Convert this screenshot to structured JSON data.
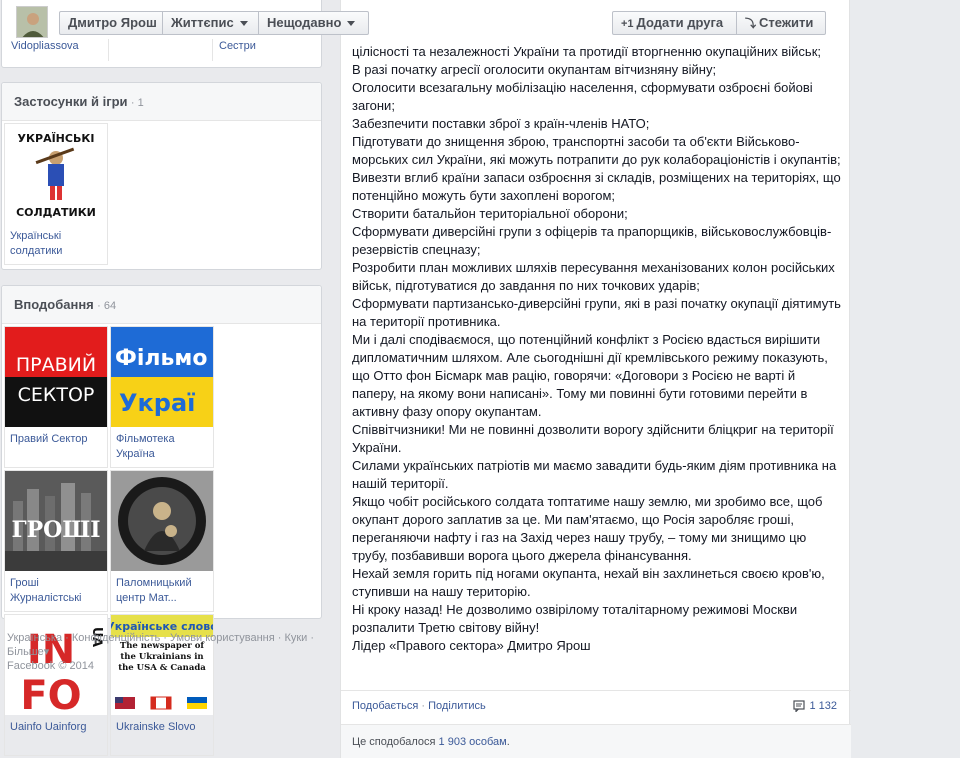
{
  "header": {
    "profile_name": "Дмитро Ярош",
    "timeline_label": "Життєпис",
    "recent_label": "Нещодавно",
    "add_friend_label": "Додати друга",
    "add_friend_icon": "+1",
    "follow_label": "Стежити",
    "follow_icon": "⤵"
  },
  "friends_tail": {
    "cells": [
      "Vidopliassova",
      "",
      "Сестри"
    ]
  },
  "apps": {
    "title": "Застосунки й ігри",
    "count": "· 1",
    "items": [
      {
        "label": "Українські солдатики",
        "art_top": "УКРАЇНСЬКІ",
        "art_bottom": "СОЛДАТИКИ"
      }
    ]
  },
  "likes": {
    "title": "Вподобання",
    "count": "· 64",
    "items": [
      {
        "label": "Правий Сектор",
        "art_line1": "ПРАВИЙ",
        "art_line2": "СЕКТОР"
      },
      {
        "label": "Фільмотека Україна",
        "art_line1": "Фільмо",
        "art_line2": "Украї"
      },
      {
        "label": "Гроші Журналістські",
        "art_line1": "ГРОШІ"
      },
      {
        "label": "Паломницький центр Мат...",
        "art_ring": "ПАЛОМНИЦЬКИЙ ЦЕНТР"
      },
      {
        "label": "Uainfo Uainforg",
        "art_line1": "IN",
        "art_line2": "FO",
        "art_badge": "UA"
      },
      {
        "label": "Ukrainske Slovo",
        "art_line1": "Українське слово",
        "art_line2": "The newspaper of the Ukrainians in the USA & Canada"
      }
    ]
  },
  "footer": {
    "links": [
      "Українська",
      "Конфіденційність",
      "Умови користування",
      "Куки",
      "Більше"
    ],
    "copyright": "Facebook © 2014"
  },
  "post": {
    "lines": [
      "цілісності та незалежності України та протидії вторгненню окупаційних військ;",
      "В разі початку агресії оголосити окупантам вітчизняну війну;",
      "Оголосити всезагальну мобілізацію населення, сформувати озброєні бойові загони;",
      "Забезпечити поставки зброї з країн-членів НАТО;",
      "Підготувати до знищення зброю, транспортні засоби та об'єкти Військово-морських сил України, які можуть потрапити до рук колабораціоністів і окупантів;",
      "Вивезти вглиб країни запаси озброєння зі складів, розміщених на територіях, що потенційно можуть бути захоплені ворогом;",
      "Створити батальйон територіальної оборони;",
      "Сформувати диверсійні групи з офіцерів та прапорщиків, військовослужбовців-резервістів спецназу;",
      "Розробити план можливих шляхів пересування механізованих колон російських військ, підготуватися до завдання по них точкових ударів;",
      "Сформувати партизансько-диверсійні групи, які в разі початку окупації діятимуть на території противника.",
      "Ми і далі сподіваємося, що потенційний конфлікт з Росією вдасться вирішити дипломатичним шляхом. Але сьогоднішні дії кремлівського режиму показують, що Отто фон Бісмарк мав рацію, говорячи: «Договори з Росією не варті й паперу, на якому вони написані». Тому ми повинні бути готовими перейти в активну фазу опору окупантам.",
      "Співвітчизники! Ми не повинні дозволити ворогу здійснити бліцкриг на території України.",
      "Силами українських патріотів ми маємо завадити будь-яким діям противника на нашій території.",
      "Якщо чобіт російського солдата топтатиме нашу землю, ми зробимо все, щоб окупант дорого заплатив за це. Ми пам'ятаємо, що Росія заробляє гроші, переганяючи нафту і газ на Захід через нашу трубу, – тому ми знищимо цю трубу, позбавивши ворога цього джерела фінансування.",
      "Нехай земля горить під ногами окупанта, нехай він захлинеться своєю кров'ю, ступивши на нашу територію.",
      "Ні кроку назад! Не дозволимо озвірілому тоталітарному режимові Москви розпалити Третю світову війну!",
      "Лідер «Правого сектора» Дмитро Ярош"
    ],
    "like_action": "Подобається",
    "share_action": "Поділитись",
    "comment_count": "1 132",
    "likes_prefix": "Це сподобалося ",
    "likes_count": "1 903 особам",
    "likes_suffix": "."
  },
  "colors": {
    "link": "#3b5998",
    "page_bg": "#e9ebee"
  }
}
